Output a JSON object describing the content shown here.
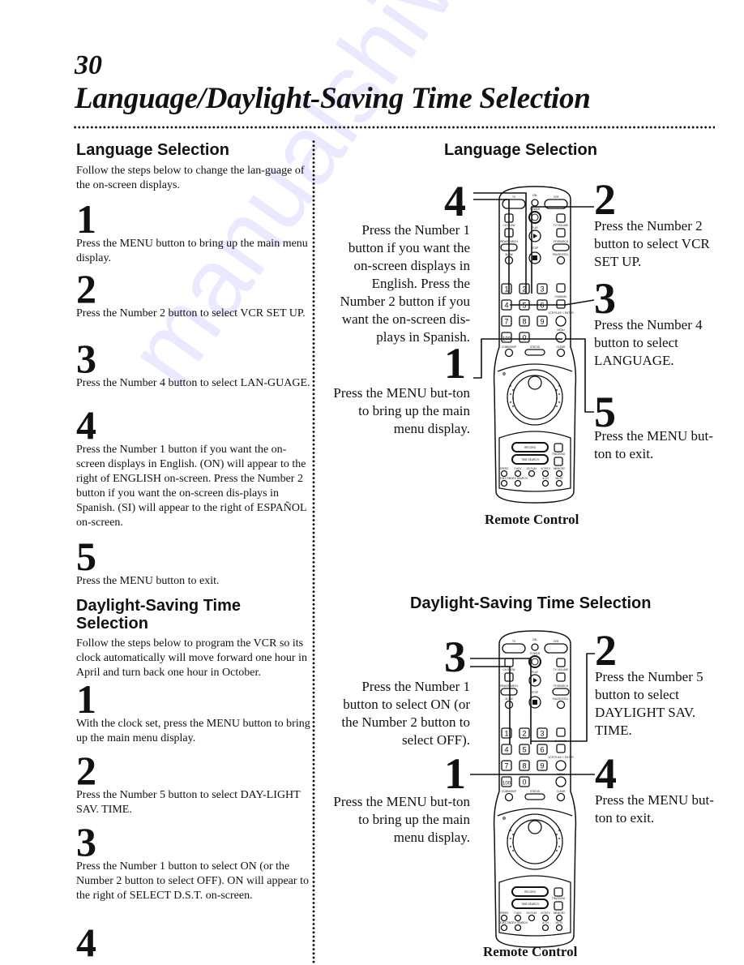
{
  "page": {
    "number": "30",
    "title": "Language/Daylight-Saving Time Selection",
    "watermark": "manualshive.com"
  },
  "language_section": {
    "heading": "Language Selection",
    "intro": "Follow the steps below to change the lan-guage of the on-screen displays.",
    "steps": [
      {
        "num": "1",
        "text": "Press the MENU button to bring up the main menu display."
      },
      {
        "num": "2",
        "text": "Press the Number 2 button to select VCR SET UP."
      },
      {
        "num": "3",
        "text": "Press the Number 4 button to select LAN-GUAGE."
      },
      {
        "num": "4",
        "text": "Press the Number 1 button if you want the on-screen displays in English. (ON) will appear to the right of ENGLISH on-screen. Press the Number 2 button if you want the on-screen dis-plays in Spanish. (SI) will appear to the right of ESPAÑOL on-screen."
      },
      {
        "num": "5",
        "text": "Press the MENU button to exit."
      }
    ]
  },
  "dst_section": {
    "heading": "Daylight-Saving Time Selection",
    "intro": "Follow the steps below to program the VCR so its clock automatically will move forward one hour in April and turn back one hour in October.",
    "steps": [
      {
        "num": "1",
        "text": "With the clock set, press the MENU button to bring up the main menu display."
      },
      {
        "num": "2",
        "text": "Press the Number 5  button to select DAY-LIGHT SAV. TIME."
      },
      {
        "num": "3",
        "text": "Press the Number 1 button to select ON (or  the Number 2 button to select OFF).  ON will appear to the right of SELECT D.S.T. on-screen."
      },
      {
        "num": "4",
        "text": ""
      }
    ]
  },
  "language_diagram": {
    "heading": "Language Selection",
    "caption": "Remote Control",
    "callouts": [
      {
        "num": "4",
        "text": "Press the Number 1 button if you want the on-screen displays in English.  Press the Number 2 button if you want the on-screen dis-plays in Spanish."
      },
      {
        "num": "1",
        "text": "Press the MENU but-ton to bring up the main menu display."
      },
      {
        "num": "2",
        "text": "Press the Number 2 button to select VCR SET UP."
      },
      {
        "num": "3",
        "text": "Press the Number 4 button to select LANGUAGE."
      },
      {
        "num": "5",
        "text": "Press the MENU but-ton to exit."
      }
    ]
  },
  "dst_diagram": {
    "heading": "Daylight-Saving Time Selection",
    "caption": "Remote Control",
    "callouts": [
      {
        "num": "3",
        "text": "Press the Number 1 button to select ON (or  the Number 2 button to select OFF)."
      },
      {
        "num": "1",
        "text": "Press the MENU but-ton to bring up the main menu display."
      },
      {
        "num": "2",
        "text": "Press the Number 5 button to select DAYLIGHT SAV. TIME."
      },
      {
        "num": "4",
        "text": "Press the MENU but-ton to exit."
      }
    ]
  },
  "remote": {
    "labels": {
      "tv": "TV",
      "cbl": "CBL",
      "vcr": "VCR",
      "power": "POWER",
      "ch_slow": "CH SLOW",
      "tv_volume": "TV VOLUME",
      "play": "PLAY",
      "rew": "REW/SEARCH",
      "ff": "FF/SEARCH",
      "slow": "SLOW",
      "stop": "STOP",
      "pause": "PAUSE/STILL",
      "channel": "CHANNEL",
      "vcrplus": "VCR PLUS+ / ENTER",
      "menu": "MENU",
      "comskip": "COMM/SKIP",
      "status": "STATUS",
      "clear": "CLEAR",
      "record": "RECORD",
      "time_search": "TIME SEARCH",
      "tracking": "TRACKING",
      "speed": "SPEED",
      "fadv": "F.ADV",
      "ssplay": "SS PLAY",
      "vcrtv": "VCR/TV",
      "memory": "MEMORY",
      "eject": "EJECT",
      "ndx": "INDEX SEARCH",
      "ach": "A.CH",
      "mute": "MUTE"
    },
    "keys": [
      "1",
      "2",
      "3",
      "4",
      "5",
      "6",
      "7",
      "8",
      "9",
      "100",
      "0"
    ]
  }
}
